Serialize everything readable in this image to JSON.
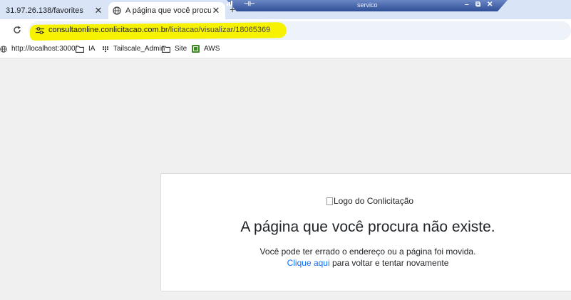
{
  "tabs": [
    {
      "title": "31.97.26.138/favorites",
      "close": "✕"
    },
    {
      "title": "A página que você procura não existe",
      "close": "✕"
    }
  ],
  "new_tab": "+",
  "remote_window": {
    "title": "servico",
    "minimize": "–",
    "restore": "⧉",
    "close": "✕",
    "pin": "⊣⊢"
  },
  "address": {
    "host": "consultaonline.conlicitacao.com.br",
    "path": "/licitacao/visualizar/18065369"
  },
  "bookmarks": [
    {
      "label": "http://localhost:3000/",
      "icon": "globe-icon"
    },
    {
      "label": "IA",
      "icon": "folder-icon"
    },
    {
      "label": "Tailscale_Admin",
      "icon": "tailscale-icon"
    },
    {
      "label": "Site",
      "icon": "folder-icon"
    },
    {
      "label": "AWS",
      "icon": "aws-icon"
    }
  ],
  "content": {
    "logo_alt": "Logo do Conlicitação",
    "heading": "A página que você procura não existe.",
    "message": "Você pode ter errado o endereço ou a página foi movida.",
    "link_text": "Clique aqui",
    "link_suffix": " para voltar e tentar novamente"
  },
  "colors": {
    "highlight": "#f7f300",
    "link": "#0d6efd",
    "tabstrip": "#d9e5f7"
  }
}
